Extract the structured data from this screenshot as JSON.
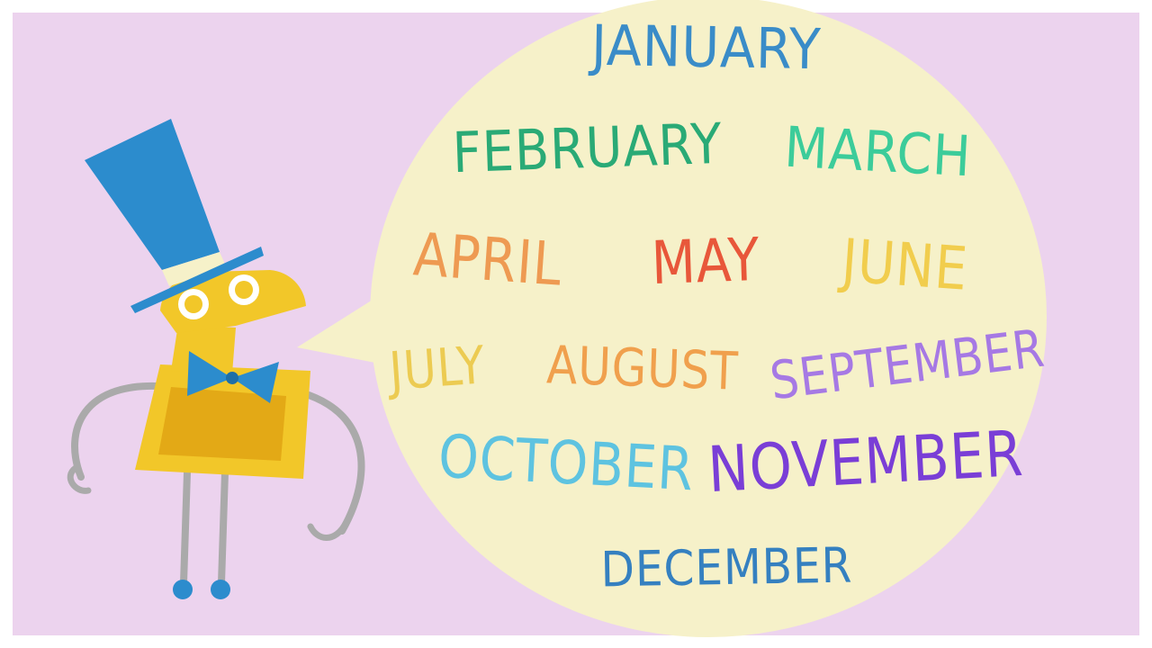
{
  "scene": {
    "background_color": "#ecd3ee",
    "bubble_color": "#f6f1c9",
    "character": "yellow-robot-with-top-hat-and-bowtie"
  },
  "months": [
    {
      "key": "january",
      "label": "JANUARY",
      "color": "#3a8cc8"
    },
    {
      "key": "february",
      "label": "FEBRUARY",
      "color": "#2aaa76"
    },
    {
      "key": "march",
      "label": "MARCH",
      "color": "#3ccc9a"
    },
    {
      "key": "april",
      "label": "APRIL",
      "color": "#ee9a52"
    },
    {
      "key": "may",
      "label": "MAY",
      "color": "#e8573a"
    },
    {
      "key": "june",
      "label": "JUNE",
      "color": "#f1cd4d"
    },
    {
      "key": "july",
      "label": "JULY",
      "color": "#eccb52"
    },
    {
      "key": "august",
      "label": "AUGUST",
      "color": "#f0a04d"
    },
    {
      "key": "september",
      "label": "SEPTEMBER",
      "color": "#a679e4"
    },
    {
      "key": "october",
      "label": "OCTOBER",
      "color": "#5ec3e0"
    },
    {
      "key": "november",
      "label": "NOVEMBER",
      "color": "#7a3ed6"
    },
    {
      "key": "december",
      "label": "DECEMBER",
      "color": "#3580c0"
    }
  ]
}
